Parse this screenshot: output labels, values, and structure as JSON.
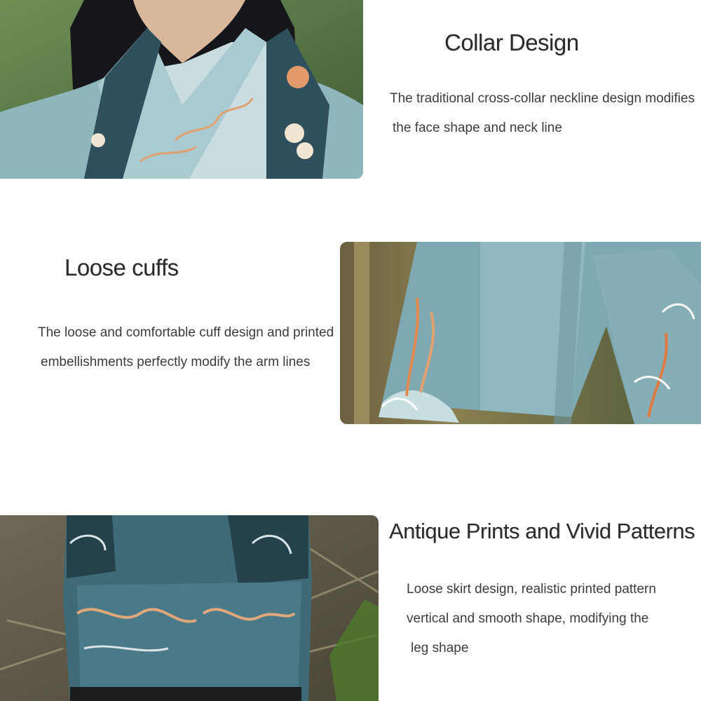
{
  "sections": [
    {
      "heading": "Collar Design",
      "lines": [
        "The traditional cross-collar neckline design modifies",
        "the face shape and neck line"
      ]
    },
    {
      "heading": "Loose cuffs",
      "lines": [
        "The loose and comfortable cuff design and printed",
        "embellishments perfectly modify the arm lines"
      ]
    },
    {
      "heading": "Antique Prints and Vivid Patterns",
      "lines": [
        "Loose skirt design, realistic printed pattern",
        "vertical and smooth shape, modifying the",
        "leg shape"
      ]
    }
  ],
  "colors": {
    "garment_light": "#8fb6bd",
    "garment_dark": "#2f4f5c",
    "background": "#ffffff"
  }
}
